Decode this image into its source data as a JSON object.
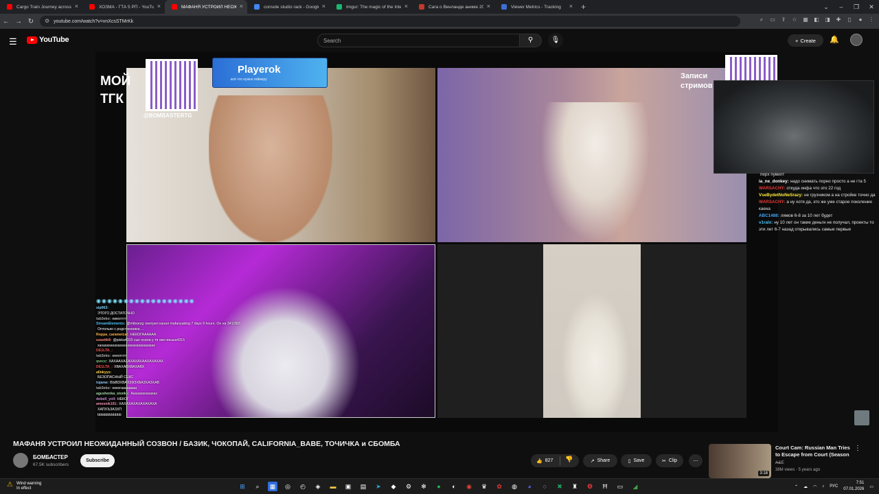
{
  "browser": {
    "tabs": [
      {
        "title": "Cargo Train Journey across Ang",
        "color": "#ff0000",
        "active": false
      },
      {
        "title": "ХОЗМА - ГТА 5 РП - YouTube",
        "color": "#ff0000",
        "active": false
      },
      {
        "title": "МАФАНЯ УСТРОИЛ НЕОЖИДА",
        "color": "#ff0000",
        "active": true
      },
      {
        "title": "console studio rack - Google S",
        "color": "#4285f4",
        "active": false
      },
      {
        "title": "Imgur: The magic of the Intern",
        "color": "#1bb76e",
        "active": false
      },
      {
        "title": "Сага о Винланде аниме 2019-",
        "color": "#c0392b",
        "active": false
      },
      {
        "title": "Viewer Metrics - Tracking",
        "color": "#3d6fd6",
        "active": false
      }
    ],
    "new_tab": "+",
    "url": "youtube.com/watch?v=vnXcsSTMrKk"
  },
  "youtube": {
    "logo_text": "YouTube",
    "search_placeholder": "Search",
    "create_label": "Create"
  },
  "overlay": {
    "tgk_line1": "МОЙ",
    "tgk_line2": "ТГК",
    "handle": "@BOMBASTERTG",
    "sponsor_name": "Playerok",
    "sponsor_tagline": "всё что нужно геймеру",
    "zapisi_line1": "Записи",
    "zapisi_line2": "стримов"
  },
  "video_chat": {
    "emotes": "◉◉◉◉◉◉◉◉◉◉◉◉◉◉◉◉◉◉",
    "lines": [
      {
        "user": "sip063:",
        "text": "",
        "color": "#7fd4ff"
      },
      {
        "user": "",
        "text": "ЭТОГО ДОСТАТОЧНО",
        "color": "#ff6b6b"
      },
      {
        "user": "tab3eko:",
        "text": "никогггггг",
        "color": "#b0b0b0"
      },
      {
        "user": "StreamElements:",
        "text": "@miboezg смотрел канал mafanyaking 7 days 9 hours. Он на 341/383748 месте.",
        "color": "#4fc3f7"
      },
      {
        "user": "",
        "text": "Оптолько с родственника ...",
        "color": "#e0a0ff"
      },
      {
        "user": "Roppa_caramelcat:",
        "text": "НЕКОГАААААА",
        "color": "#ffb74d"
      },
      {
        "user": "uzasttk9:",
        "text": "@piska4315 сын осела у тя ник писька4315",
        "color": "#ff8a80"
      },
      {
        "user": "",
        "text": "хахахахахахахахахахахахахахахах",
        "color": "#b39ddb"
      },
      {
        "user": "DE1LTA_:",
        "text": "",
        "color": "#ef5350"
      },
      {
        "user": "tab3eko:",
        "text": "нееоггггг",
        "color": "#b0b0b0"
      },
      {
        "user": "qvecc:",
        "text": "ХАХААХАХАХАХАХААХАХАХАХ",
        "color": "#81c784"
      },
      {
        "user": "DE1LTA_:",
        "text": "ХВАХАВХВАХАВХ",
        "color": "#ef5350"
      },
      {
        "user": "allnkyys:",
        "text": "",
        "color": "#ffd54f"
      },
      {
        "user": "",
        "text": "БЕЗОПАСНЫЙ СЕКС",
        "color": "#ff6b6b"
      },
      {
        "user": "tojanw:",
        "text": "ВЫВЗХВАХЗФЗХВАЗХАЗХАВ",
        "color": "#90caf9"
      },
      {
        "user": "tab3eko:",
        "text": "некогаааааааа",
        "color": "#b0b0b0"
      },
      {
        "user": "agushenka_stonks:",
        "text": "Ахахахахахахах",
        "color": "#a5d6a7"
      },
      {
        "user": "dobell_yoll:",
        "text": "НЕКОГ",
        "color": "#ce93d8"
      },
      {
        "user": "amesnik191:",
        "text": "ХАХАХАХАХАХАХАХА",
        "color": "#f48fb1"
      },
      {
        "user": "",
        "text": "ХАПХЪЗАЗХП",
        "color": "#ff5252"
      },
      {
        "user": "",
        "text": "bbbbbbbbbbbb",
        "color": "#bdbdbd"
      }
    ]
  },
  "side_chat": {
    "lines": [
      {
        "user": "",
        "text": "перх пувилт",
        "color": "#9e9e9e"
      },
      {
        "user": "ia_ne_donkey:",
        "text": "надо снимать порно просто а не гта 5",
        "color": "#ffffff"
      },
      {
        "user": "WARSACHY:",
        "text": "откуда инфа что это 22 год",
        "color": "#e53935"
      },
      {
        "user": "VseBydetNoNeSrazy:",
        "text": "не грузчиком а на стройке точно да",
        "color": "#ffeb3b"
      },
      {
        "user": "WARSACHY:",
        "text": "а ну хотя да, это же уже старое поколение каена",
        "color": "#e53935"
      },
      {
        "user": "ABC1488:",
        "text": "лямов 6-8 за 10 лет будет",
        "color": "#42a5f5"
      },
      {
        "user": "v1ralx:",
        "text": "ну 10 лет он такие деньги не получал, проекты то эти лет 6-7 назад открывались самые первые",
        "color": "#4fc3f7"
      }
    ]
  },
  "video": {
    "title": "МАФАНЯ УСТРОИЛ НЕОЖИДАННЫЙ СОЗВОН / БАЗИК, ЧОКОПАЙ, CALIFORNIA_BABE, ТОЧИЧКА и СБОМБА",
    "channel": "БОМБАСТЕР",
    "subscribers": "67.5K subscribers",
    "subscribe_label": "Subscribe",
    "likes": "827",
    "share_label": "Share",
    "save_label": "Save",
    "clip_label": "Clip"
  },
  "recommended": {
    "title": "Court Cam: Russian Man Tries to Escape from Court (Season ...",
    "channel": "A&E",
    "meta": "38M views · 5 years ago",
    "duration": "3:18"
  },
  "taskbar": {
    "weather_line1": "Wind warning",
    "weather_line2": "In effect",
    "lang": "РУС",
    "time": "7:51",
    "date": "07.01.2026"
  }
}
